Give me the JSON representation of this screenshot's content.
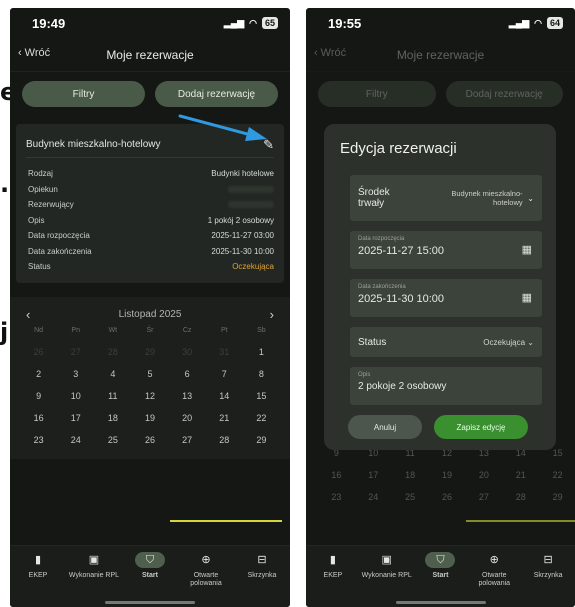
{
  "background_fragments": {
    "e": "e",
    "dot": ".",
    "ji": "ji"
  },
  "left": {
    "status": {
      "time": "19:49",
      "battery": "65"
    },
    "nav": {
      "back": "Wróć",
      "title": "Moje rezerwacje"
    },
    "buttons": {
      "filters": "Filtry",
      "add": "Dodaj rezerwację"
    },
    "card": {
      "title": "Budynek mieszkalno-hotelowy",
      "rows": [
        {
          "label": "Rodzaj",
          "value": "Budynki hotelowe"
        },
        {
          "label": "Opiekun",
          "value": ""
        },
        {
          "label": "Rezerwujący",
          "value": ""
        },
        {
          "label": "Opis",
          "value": "1 pokój 2 osobowy"
        },
        {
          "label": "Data rozpoczęcia",
          "value": "2025-11-27 03:00"
        },
        {
          "label": "Data zakończenia",
          "value": "2025-11-30 10:00"
        },
        {
          "label": "Status",
          "value": "Oczekująca"
        }
      ]
    },
    "calendar": {
      "month": "Listopad 2025",
      "prev": "‹",
      "next": "›",
      "weekdays": [
        "Nd",
        "Pn",
        "Wt",
        "Śr",
        "Cz",
        "Pt",
        "Sb"
      ],
      "weeks": [
        [
          "26",
          "27",
          "28",
          "29",
          "30",
          "31",
          "1"
        ],
        [
          "2",
          "3",
          "4",
          "5",
          "6",
          "7",
          "8"
        ],
        [
          "9",
          "10",
          "11",
          "12",
          "13",
          "14",
          "15"
        ],
        [
          "16",
          "17",
          "18",
          "19",
          "20",
          "21",
          "22"
        ],
        [
          "23",
          "24",
          "25",
          "26",
          "27",
          "28",
          "29"
        ]
      ]
    },
    "tabs": [
      {
        "label": "EKEP",
        "icon": "book-icon"
      },
      {
        "label": "Wykonanie RPL",
        "icon": "calendar-check-icon"
      },
      {
        "label": "Start",
        "icon": "shield-icon"
      },
      {
        "label": "Otwarte polowania",
        "icon": "target-icon"
      },
      {
        "label": "Skrzynka",
        "icon": "inbox-icon"
      }
    ]
  },
  "right": {
    "status": {
      "time": "19:55",
      "battery": "64"
    },
    "nav": {
      "back": "Wróć",
      "title": "Moje rezerwacje"
    },
    "buttons": {
      "filters": "Filtry",
      "add": "Dodaj rezerwację"
    },
    "modal": {
      "title": "Edycja rezerwacji",
      "asset_label": "Środek trwały",
      "asset_value": "Budynek mieszkalno-hotelowy",
      "start_label": "Data rozpoczęcia",
      "start_value": "2025-11-27 15:00",
      "end_label": "Data zakończenia",
      "end_value": "2025-11-30 10:00",
      "status_label": "Status",
      "status_value": "Oczekująca",
      "desc_label": "Opis",
      "desc_value": "2 pokoje 2 osobowy",
      "cancel": "Anuluj",
      "save": "Zapisz edycję"
    },
    "calendar": {
      "weeks": [
        [
          "9",
          "10",
          "11",
          "12",
          "13",
          "14",
          "15"
        ],
        [
          "16",
          "17",
          "18",
          "19",
          "20",
          "21",
          "22"
        ],
        [
          "23",
          "24",
          "25",
          "26",
          "27",
          "28",
          "29"
        ]
      ]
    },
    "tabs": [
      {
        "label": "EKEP",
        "icon": "book-icon"
      },
      {
        "label": "Wykonanie RPL",
        "icon": "calendar-check-icon"
      },
      {
        "label": "Start",
        "icon": "shield-icon"
      },
      {
        "label": "Otwarte polowania",
        "icon": "target-icon"
      },
      {
        "label": "Skrzynka",
        "icon": "inbox-icon"
      }
    ]
  },
  "colors": {
    "accent_green": "#3a8f2f",
    "pending": "#e0a234",
    "highlight": "#d8d438",
    "arrow": "#2f9ae0"
  }
}
